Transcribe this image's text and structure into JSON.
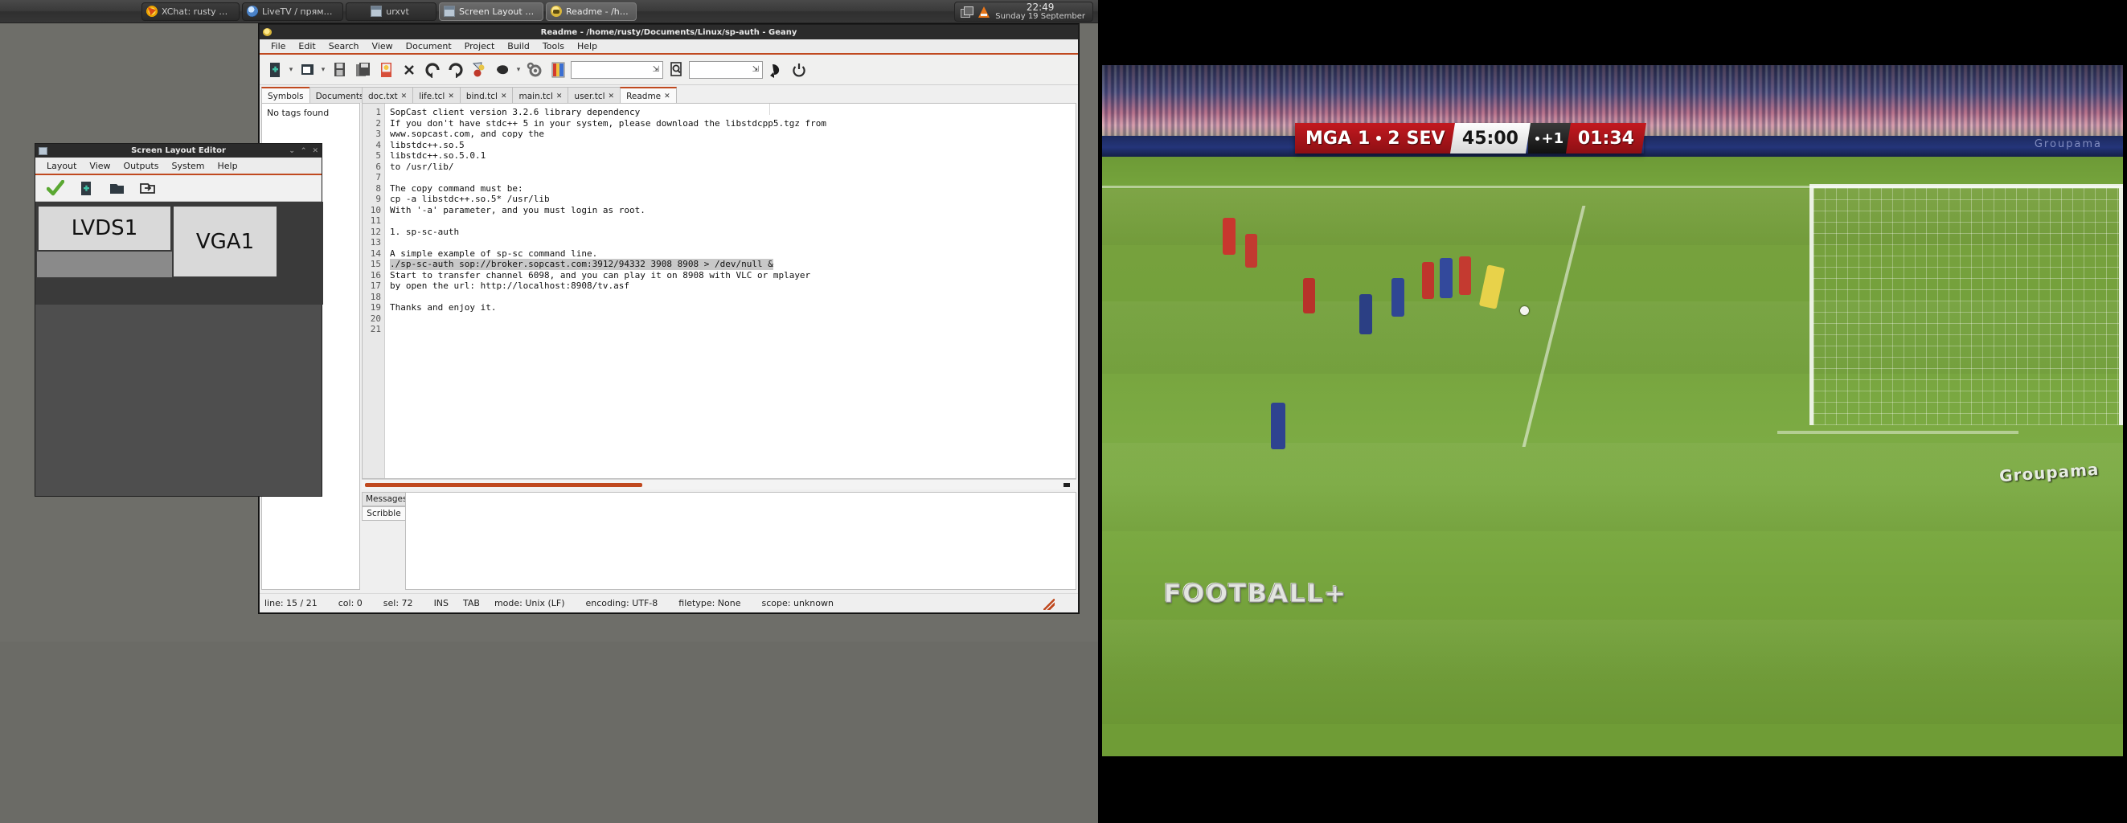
{
  "taskbar": {
    "items": [
      {
        "label": "XChat: rusty @ RusN...",
        "icon": "xchat-icon",
        "active": false
      },
      {
        "label": "LiveTV / прямая тра...",
        "icon": "livetv-icon",
        "active": false
      },
      {
        "label": "urxvt",
        "icon": "terminal-icon",
        "active": false
      },
      {
        "label": "Screen Layout Editor",
        "icon": "screen-layout-icon",
        "active": true
      },
      {
        "label": "Readme - /home/rust...",
        "icon": "geany-icon",
        "active": true
      }
    ],
    "tray": {
      "workspace_icon": "windows-icon",
      "vlc_icon": "vlc-cone-icon"
    },
    "clock": {
      "time": "22:49",
      "date": "Sunday 19 September"
    }
  },
  "geany": {
    "title": "Readme - /home/rusty/Documents/Linux/sp-auth - Geany",
    "app_icon": "geany-icon",
    "window_buttons": {
      "minimize": "⌄",
      "maximize": "⌃",
      "close": "✕"
    },
    "menu": [
      "File",
      "Edit",
      "Search",
      "View",
      "Document",
      "Project",
      "Build",
      "Tools",
      "Help"
    ],
    "toolbar": {
      "new_label": "New",
      "open_label": "Open",
      "save_label": "Save",
      "save_all_label": "Save All",
      "revert_label": "Revert",
      "close_label": "Close",
      "back_label": "Back",
      "forward_label": "Forward",
      "compile_label": "Compile",
      "build_label": "Build",
      "preferences_label": "Preferences",
      "color_label": "Color Chooser",
      "search_value": "",
      "search_placeholder": "",
      "goto_value": "",
      "goto_placeholder": "",
      "jump_label": "Jump to",
      "quit_label": "Quit"
    },
    "sidebar": {
      "tabs": [
        {
          "label": "Symbols",
          "selected": true
        },
        {
          "label": "Documents",
          "selected": false
        }
      ],
      "content": "No tags found"
    },
    "editor_tabs": [
      {
        "label": "doc.txt",
        "selected": false
      },
      {
        "label": "life.tcl",
        "selected": false
      },
      {
        "label": "bind.tcl",
        "selected": false
      },
      {
        "label": "main.tcl",
        "selected": false
      },
      {
        "label": "user.tcl",
        "selected": false
      },
      {
        "label": "Readme",
        "selected": true
      }
    ],
    "close_glyph": "✕",
    "document": {
      "lines": [
        {
          "n": "1",
          "text": "SopCast client version 3.2.6 library dependency",
          "selected": false
        },
        {
          "n": "2",
          "text": "If you don't have stdc++ 5 in your system, please download the libstdcpp5.tgz from",
          "selected": false
        },
        {
          "n": "3",
          "text": "www.sopcast.com, and copy the",
          "selected": false
        },
        {
          "n": "4",
          "text": "libstdc++.so.5",
          "selected": false
        },
        {
          "n": "5",
          "text": "libstdc++.so.5.0.1",
          "selected": false
        },
        {
          "n": "6",
          "text": "to /usr/lib/",
          "selected": false
        },
        {
          "n": "7",
          "text": "",
          "selected": false
        },
        {
          "n": "8",
          "text": "The copy command must be:",
          "selected": false
        },
        {
          "n": "9",
          "text": "cp -a libstdc++.so.5* /usr/lib",
          "selected": false
        },
        {
          "n": "10",
          "text": "With '-a' parameter, and you must login as root.",
          "selected": false
        },
        {
          "n": "11",
          "text": "",
          "selected": false
        },
        {
          "n": "12",
          "text": "1. sp-sc-auth",
          "selected": false
        },
        {
          "n": "13",
          "text": "",
          "selected": false
        },
        {
          "n": "14",
          "text": "A simple example of sp-sc command line.",
          "selected": false
        },
        {
          "n": "15",
          "text": "./sp-sc-auth sop://broker.sopcast.com:3912/94332 3908 8908 > /dev/null &",
          "selected": true
        },
        {
          "n": "16",
          "text": "Start to transfer channel 6098, and you can play it on 8908 with VLC or mplayer",
          "selected": false
        },
        {
          "n": "17",
          "text": "by open the url: http://localhost:8908/tv.asf",
          "selected": false
        },
        {
          "n": "18",
          "text": "",
          "selected": false
        },
        {
          "n": "19",
          "text": "Thanks and enjoy it.",
          "selected": false
        },
        {
          "n": "20",
          "text": "",
          "selected": false
        },
        {
          "n": "21",
          "text": "",
          "selected": false
        }
      ]
    },
    "message_tabs": [
      {
        "label": "Messages",
        "selected": false
      },
      {
        "label": "Scribble",
        "selected": true
      }
    ],
    "statusbar": [
      "line: 15 / 21",
      "col: 0",
      "sel: 72",
      "INS",
      "TAB",
      "mode: Unix (LF)",
      "encoding: UTF-8",
      "filetype: None",
      "scope: unknown"
    ]
  },
  "screen_layout_editor": {
    "title": "Screen Layout Editor",
    "app_icon": "screen-layout-icon",
    "window_buttons": {
      "minimize": "⌄",
      "maximize": "⌃",
      "close": "✕"
    },
    "menu": [
      "Layout",
      "View",
      "Outputs",
      "System",
      "Help"
    ],
    "toolbar": {
      "apply_label": "Apply",
      "new_label": "New",
      "open_label": "Open",
      "save_as_label": "Save As"
    },
    "outputs": [
      {
        "name": "LVDS1"
      },
      {
        "name": "VGA1"
      }
    ]
  },
  "video": {
    "scorebug": {
      "home_team": "MGA",
      "home_score": "1",
      "away_score": "2",
      "away_team": "SEV",
      "clock": "45:00",
      "added_time": "+1",
      "extra_clock": "01:34"
    },
    "watermark": "FOOTBALL+",
    "sponsor_board": "Groupama",
    "ad_board_brand": "Groupama"
  }
}
